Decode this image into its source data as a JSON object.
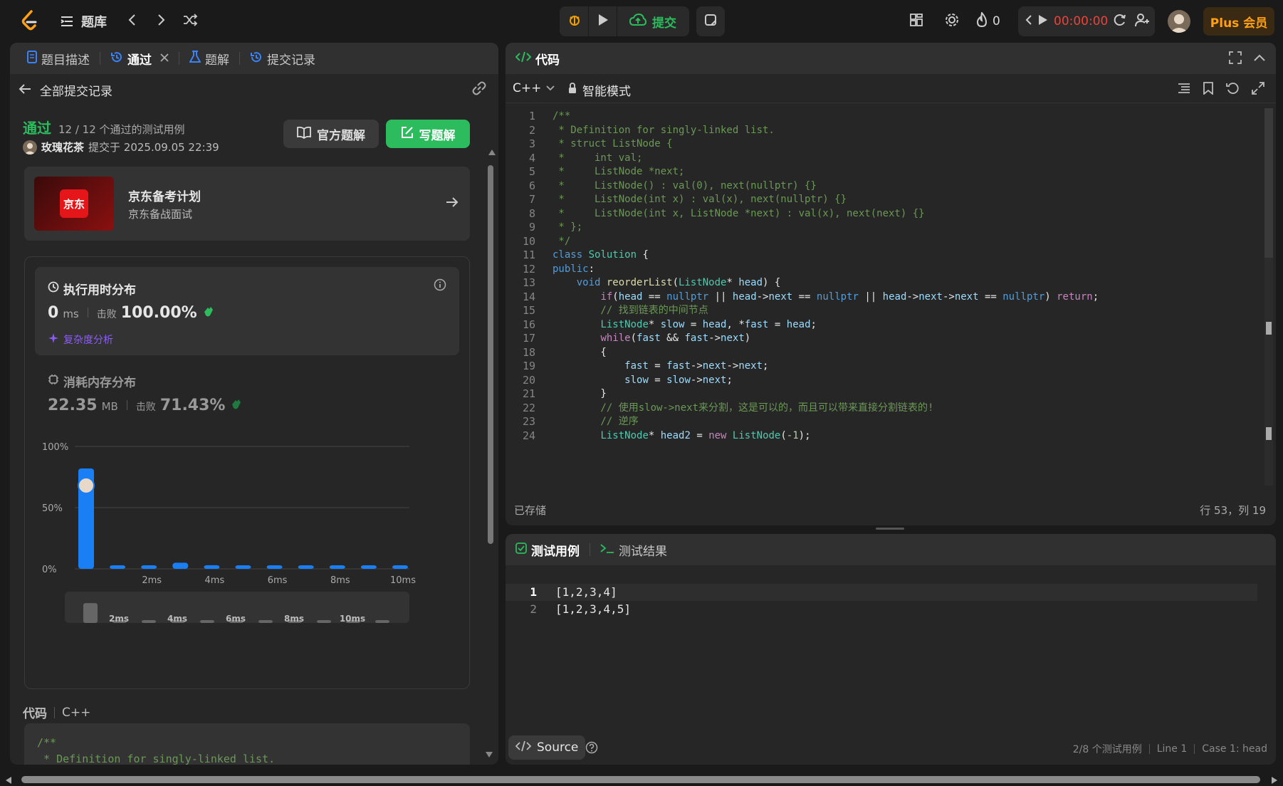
{
  "topbar": {
    "problem_bank": "题库",
    "submit": "提交",
    "streak": "0",
    "timer": "00:00:00",
    "plus": "Plus 会员"
  },
  "left": {
    "tabs": [
      {
        "label": "题目描述"
      },
      {
        "label": "通过"
      },
      {
        "label": "题解"
      },
      {
        "label": "提交记录"
      }
    ],
    "back_label": "全部提交记录",
    "status": "通过",
    "passed_cases": "12 / 12 个通过的测试用例",
    "user": "玫瑰花茶",
    "submitted_at": "提交于 2025.09.05 22:39",
    "official_solution": "官方题解",
    "write_solution": "写题解",
    "promo": {
      "logo": "京东",
      "title": "京东备考计划",
      "subtitle": "京东备战面试"
    },
    "runtime": {
      "title": "执行用时分布",
      "value": "0",
      "unit": "ms",
      "beat_label": "击败",
      "beat": "100.00%",
      "complexity": "复杂度分析"
    },
    "memory": {
      "title": "消耗内存分布",
      "value": "22.35",
      "unit": "MB",
      "beat_label": "击败",
      "beat": "71.43%"
    },
    "code_label": "代码",
    "code_lang": "C++",
    "code_preview": [
      "/**",
      " * Definition for singly-linked list."
    ]
  },
  "chart_data": {
    "type": "bar",
    "title": "执行用时分布",
    "y_ticks": [
      "100%",
      "50%",
      "0%"
    ],
    "x_ticks": [
      "2ms",
      "4ms",
      "6ms",
      "8ms",
      "10ms"
    ],
    "ylim": [
      0,
      100
    ],
    "values": [
      82,
      2,
      2,
      5,
      3,
      2,
      2,
      2,
      2,
      2,
      2
    ],
    "highlight_index": 0,
    "overview_x_ticks": [
      "2ms",
      "4ms",
      "6ms",
      "8ms",
      "10ms"
    ],
    "bar_color": "#1a7ef5"
  },
  "editor": {
    "title": "代码",
    "lang": "C++",
    "mode": "智能模式",
    "saved": "已存储",
    "cursor": "行 53，列 19",
    "lines": [
      "/**",
      " * Definition for singly-linked list.",
      " * struct ListNode {",
      " *     int val;",
      " *     ListNode *next;",
      " *     ListNode() : val(0), next(nullptr) {}",
      " *     ListNode(int x) : val(x), next(nullptr) {}",
      " *     ListNode(int x, ListNode *next) : val(x), next(next) {}",
      " * };",
      " */",
      "class Solution {",
      "public:",
      "    void reorderList(ListNode* head) {",
      "        if(head == nullptr || head->next == nullptr || head->next->next == nullptr) return;",
      "        // 找到链表的中间节点",
      "        ListNode* slow = head, *fast = head;",
      "        while(fast && fast->next)",
      "        {",
      "            fast = fast->next->next;",
      "            slow = slow->next;",
      "        }",
      "        // 使用slow->next来分割，这是可以的，而且可以带来直接分割链表的!",
      "        // 逆序",
      "        ListNode* head2 = new ListNode(-1);"
    ]
  },
  "testpanel": {
    "tab_cases": "测试用例",
    "tab_results": "测试结果",
    "cases": [
      "[1,2,3,4]",
      "[1,2,3,4,5]"
    ],
    "source": "Source",
    "status_cases": "2/8 个测试用例",
    "status_line": "Line 1",
    "status_case": "Case 1: head"
  }
}
